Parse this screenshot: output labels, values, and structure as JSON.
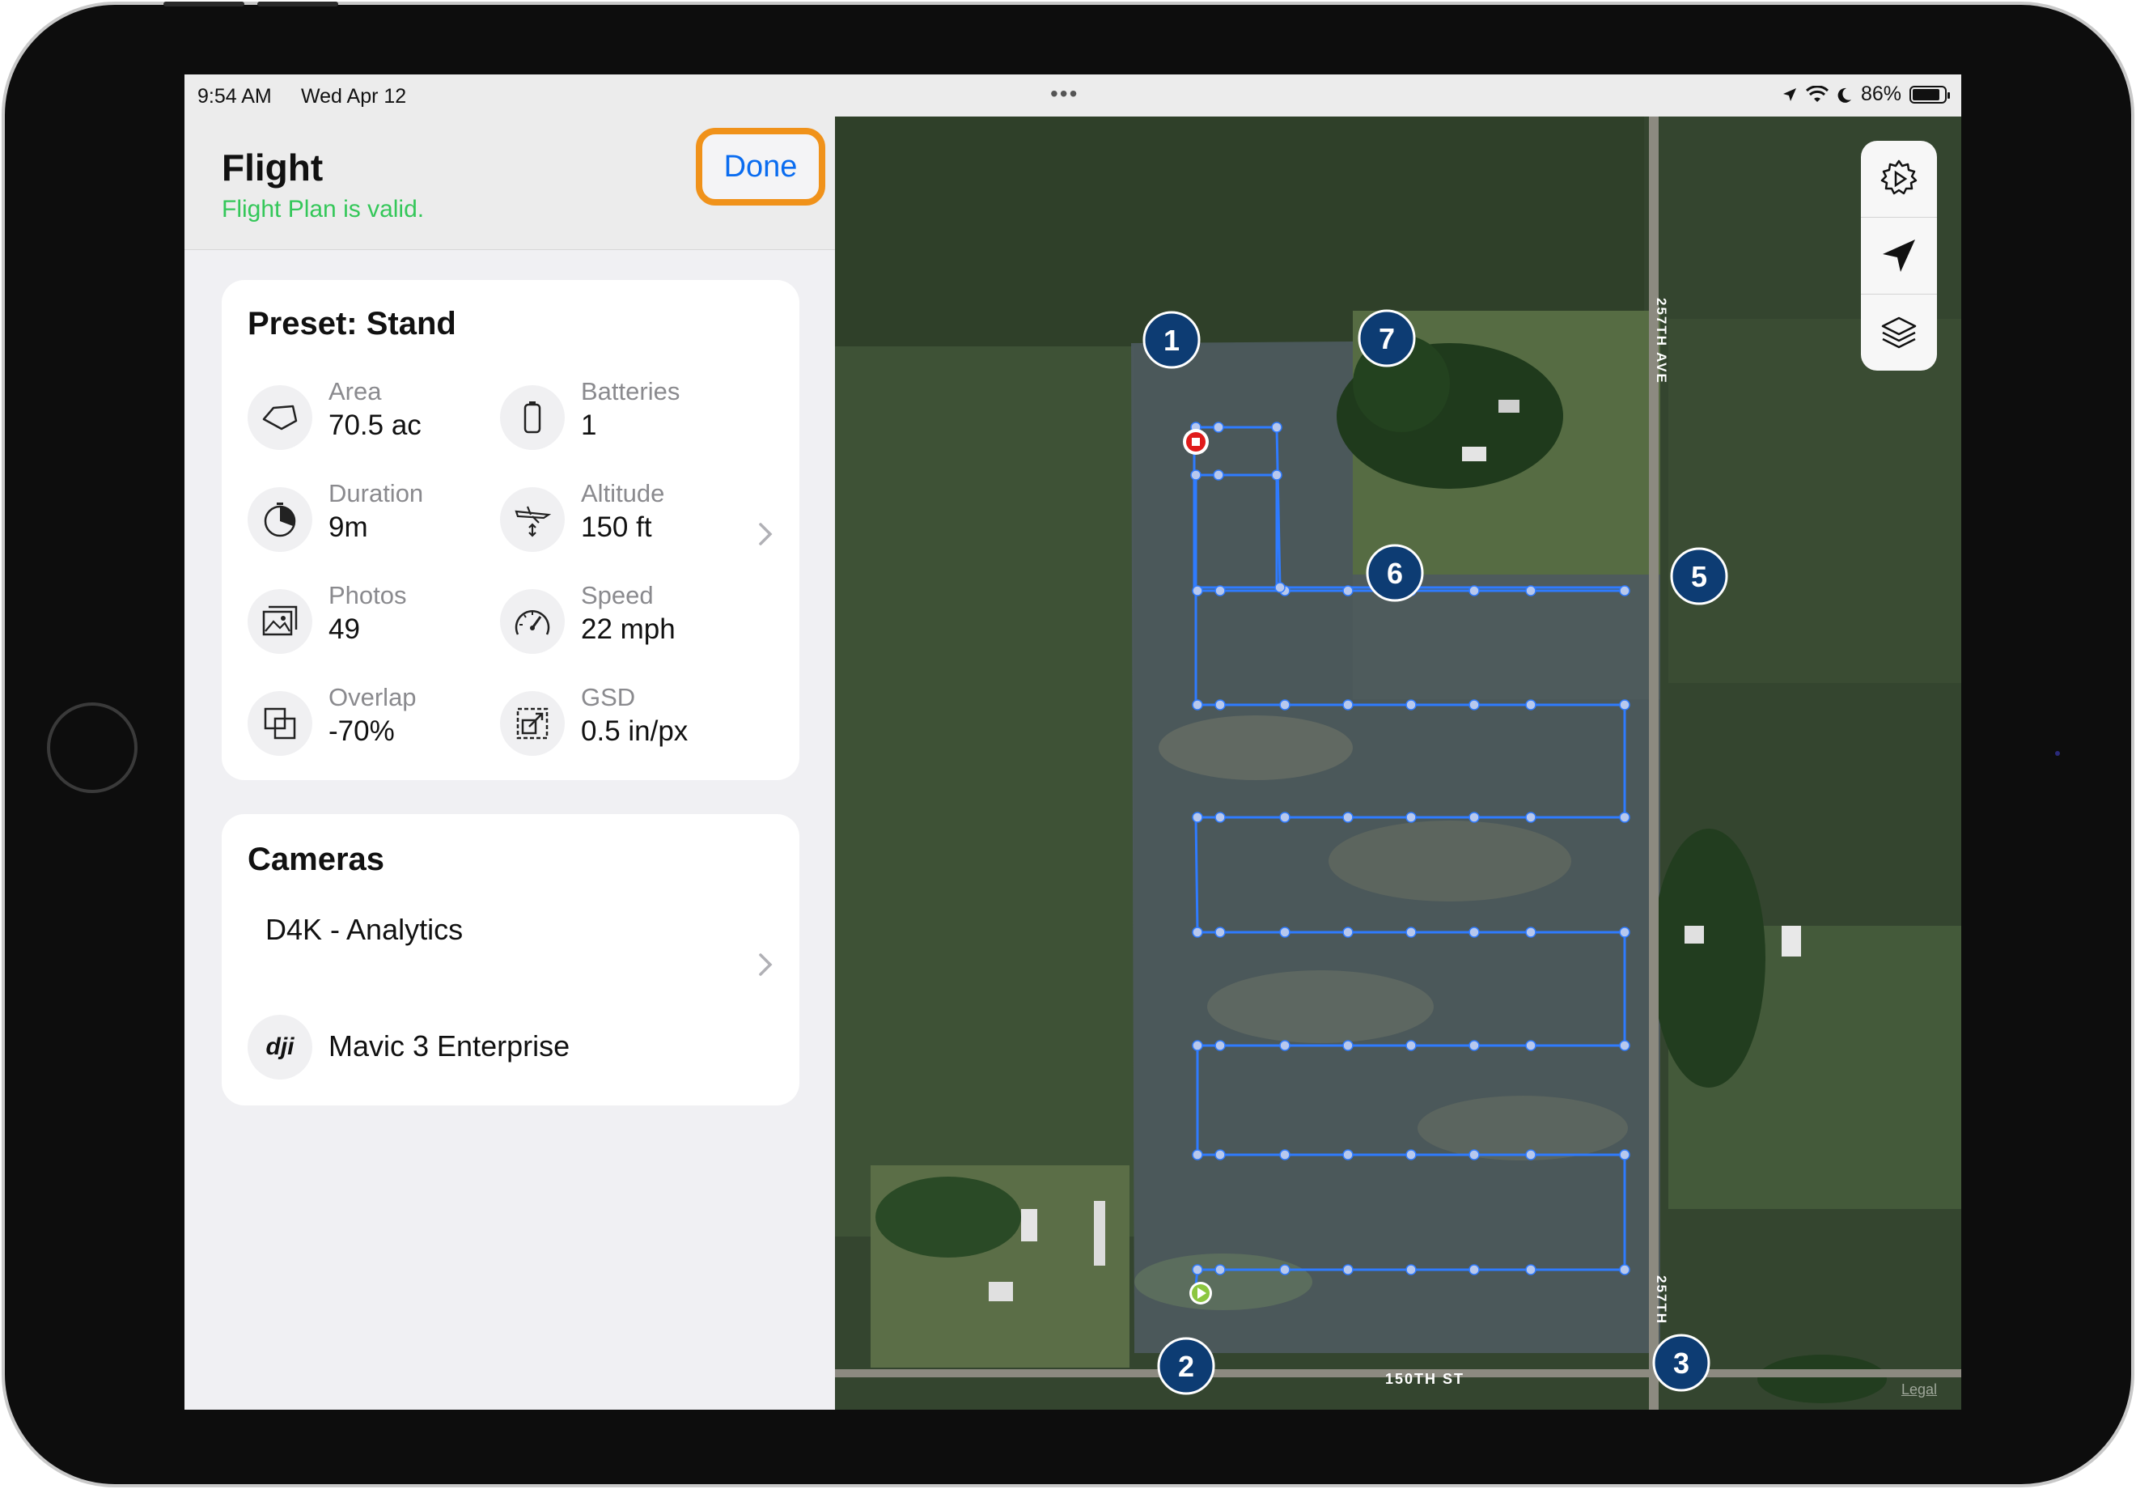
{
  "status_bar": {
    "time": "9:54 AM",
    "date": "Wed Apr 12",
    "battery": "86%",
    "battery_level": 0.86
  },
  "header": {
    "title": "Flight",
    "subtitle": "Flight Plan is valid.",
    "done_label": "Done"
  },
  "preset": {
    "title": "Preset: Stand",
    "stats": [
      {
        "label": "Area",
        "value": "70.5 ac",
        "icon": "area-icon"
      },
      {
        "label": "Batteries",
        "value": "1",
        "icon": "battery-icon"
      },
      {
        "label": "Duration",
        "value": "9m",
        "icon": "timer-icon"
      },
      {
        "label": "Altitude",
        "value": "150 ft",
        "icon": "altitude-icon"
      },
      {
        "label": "Photos",
        "value": "49",
        "icon": "photos-icon"
      },
      {
        "label": "Speed",
        "value": "22 mph",
        "icon": "speedometer-icon"
      },
      {
        "label": "Overlap",
        "value": "-70%",
        "icon": "overlap-icon"
      },
      {
        "label": "GSD",
        "value": "0.5 in/px",
        "icon": "gsd-icon"
      }
    ]
  },
  "cameras": {
    "title": "Cameras",
    "camera": "D4K - Analytics",
    "drone": "Mavic 3 Enterprise"
  },
  "map": {
    "road_labels": {
      "avenue_top": "257TH AVE",
      "street": "150TH ST",
      "avenue_bottom": "257TH"
    },
    "markers": [
      "1",
      "2",
      "3",
      "5",
      "6",
      "7"
    ],
    "legal": "Legal",
    "route_color": "#2f7bff",
    "start_color": "#8cc63f",
    "end_color": "#e01b1b",
    "marker_color": "#0d3c73"
  }
}
